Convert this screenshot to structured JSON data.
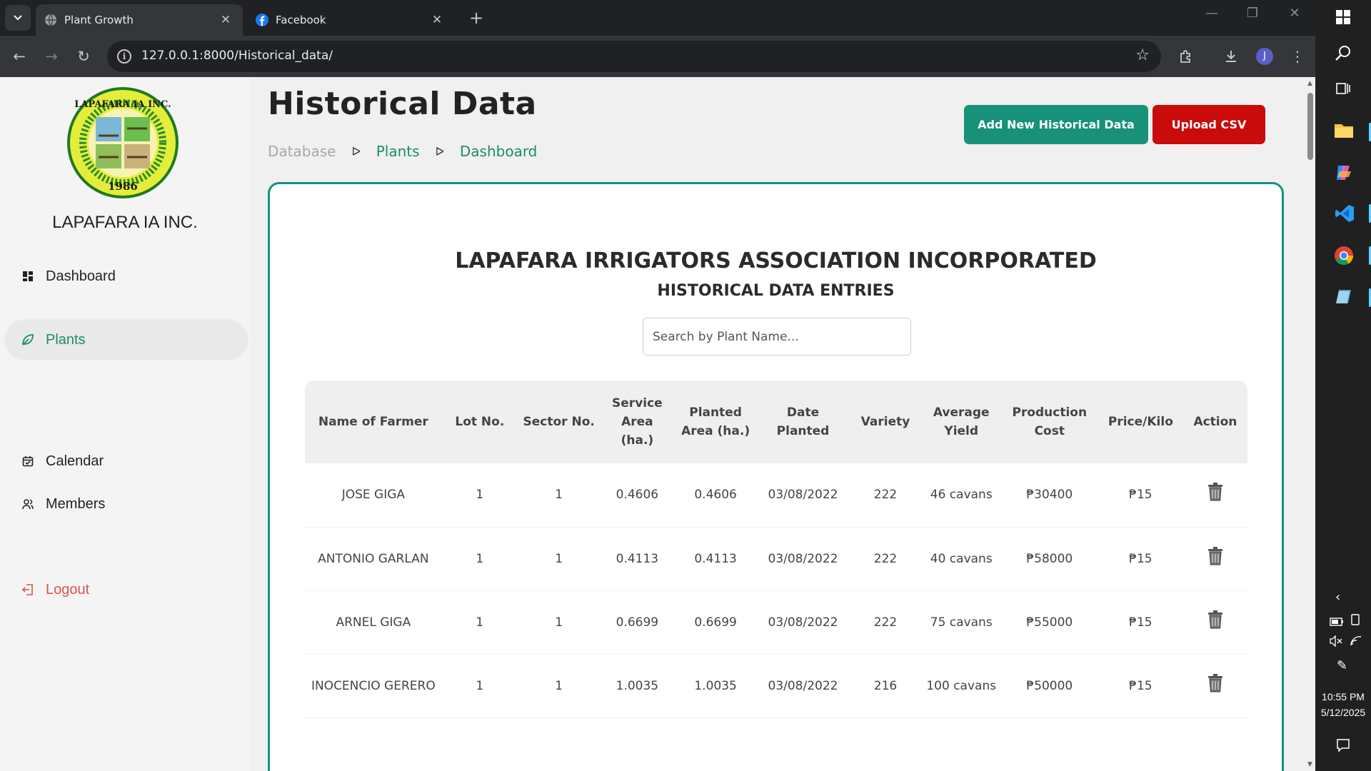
{
  "browser": {
    "tabs": [
      {
        "title": "Plant Growth",
        "active": true,
        "favicon": "globe-icon"
      },
      {
        "title": "Facebook",
        "active": false,
        "favicon": "facebook-icon"
      }
    ],
    "url": "127.0.0.1:8000/Historical_data/",
    "avatar_letter": "J"
  },
  "sidebar": {
    "org_name": "LAPAFARA IA INC.",
    "logo": {
      "top_text": "LAPAFARA IA INC.",
      "year": "1986"
    },
    "items": [
      {
        "label": "Dashboard",
        "icon": "grid-icon",
        "active": false
      },
      {
        "label": "Plants",
        "icon": "leaf-icon",
        "active": true
      },
      {
        "label": "Calendar",
        "icon": "calendar-icon",
        "active": false
      },
      {
        "label": "Members",
        "icon": "users-icon",
        "active": false
      }
    ],
    "logout_label": "Logout"
  },
  "header": {
    "title": "Historical Data",
    "breadcrumb": [
      "Database",
      "Plants",
      "Dashboard"
    ],
    "add_button": "Add New Historical Data",
    "upload_button": "Upload CSV"
  },
  "card": {
    "title": "LAPAFARA IRRIGATORS ASSOCIATION INCORPORATED",
    "subtitle": "HISTORICAL DATA ENTRIES",
    "search_placeholder": "Search by Plant Name..."
  },
  "table": {
    "headers": [
      "Name of Farmer",
      "Lot No.",
      "Sector No.",
      "Service Area (ha.)",
      "Planted Area (ha.)",
      "Date Planted",
      "Variety",
      "Average Yield",
      "Production Cost",
      "Price/Kilo",
      "Action"
    ],
    "rows": [
      {
        "farmer": "JOSE GIGA",
        "lot": "1",
        "sector": "1",
        "service_area": "0.4606",
        "planted_area": "0.4606",
        "date_planted": "03/08/2022",
        "variety": "222",
        "avg_yield": "46 cavans",
        "cost": "₱30400",
        "price": "₱15"
      },
      {
        "farmer": "ANTONIO GARLAN",
        "lot": "1",
        "sector": "1",
        "service_area": "0.4113",
        "planted_area": "0.4113",
        "date_planted": "03/08/2022",
        "variety": "222",
        "avg_yield": "40 cavans",
        "cost": "₱58000",
        "price": "₱15"
      },
      {
        "farmer": "ARNEL GIGA",
        "lot": "1",
        "sector": "1",
        "service_area": "0.6699",
        "planted_area": "0.6699",
        "date_planted": "03/08/2022",
        "variety": "222",
        "avg_yield": "75 cavans",
        "cost": "₱55000",
        "price": "₱15"
      },
      {
        "farmer": "INOCENCIO GERERO",
        "lot": "1",
        "sector": "1",
        "service_area": "1.0035",
        "planted_area": "1.0035",
        "date_planted": "03/08/2022",
        "variety": "216",
        "avg_yield": "100 cavans",
        "cost": "₱50000",
        "price": "₱15"
      }
    ]
  },
  "taskbar": {
    "time": "10:55 PM",
    "date": "5/12/2025"
  },
  "colors": {
    "accent": "#17917a",
    "danger": "#c90b0b",
    "logout": "#d9534f"
  }
}
